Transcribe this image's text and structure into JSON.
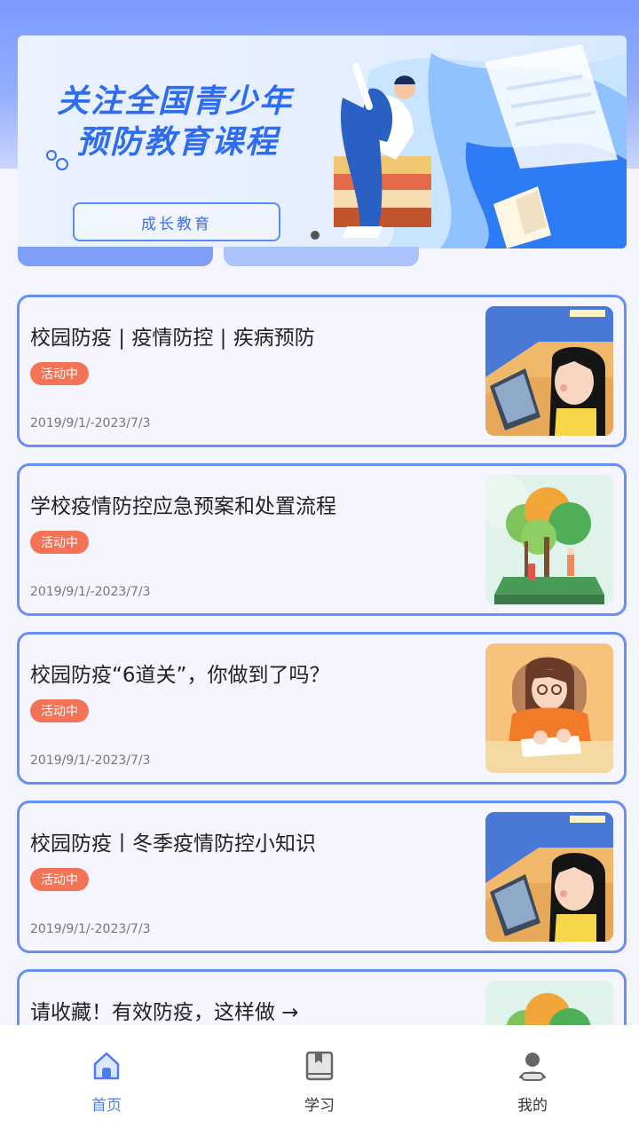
{
  "banner": {
    "title_line1": "关注全国青少年",
    "title_line2": "预防教育课程",
    "button_label": "成长教育"
  },
  "list": [
    {
      "title": "校园防疫 | 疫情防控 | 疾病预防",
      "badge": "活动中",
      "date": "2019/9/1/-2023/7/3",
      "thumb": "girl-laptop"
    },
    {
      "title": "学校疫情防控应急预案和处置流程",
      "badge": "活动中",
      "date": "2019/9/1/-2023/7/3",
      "thumb": "tree-book"
    },
    {
      "title": "校园防疫“6道关”，你做到了吗？",
      "badge": "活动中",
      "date": "2019/9/1/-2023/7/3",
      "thumb": "girl-writing"
    },
    {
      "title": "校园防疫丨冬季疫情防控小知识",
      "badge": "活动中",
      "date": "2019/9/1/-2023/7/3",
      "thumb": "girl-laptop"
    },
    {
      "title": "请收藏！有效防疫，这样做 →",
      "badge": "",
      "date": "",
      "thumb": "tree-book"
    }
  ],
  "nav": {
    "items": [
      {
        "label": "首页",
        "icon": "home-icon",
        "active": true
      },
      {
        "label": "学习",
        "icon": "book-icon",
        "active": false
      },
      {
        "label": "我的",
        "icon": "user-icon",
        "active": false
      }
    ]
  },
  "colors": {
    "accent": "#4d7cf2",
    "badge": "#f47256",
    "card_border": "#6a8ff2"
  }
}
